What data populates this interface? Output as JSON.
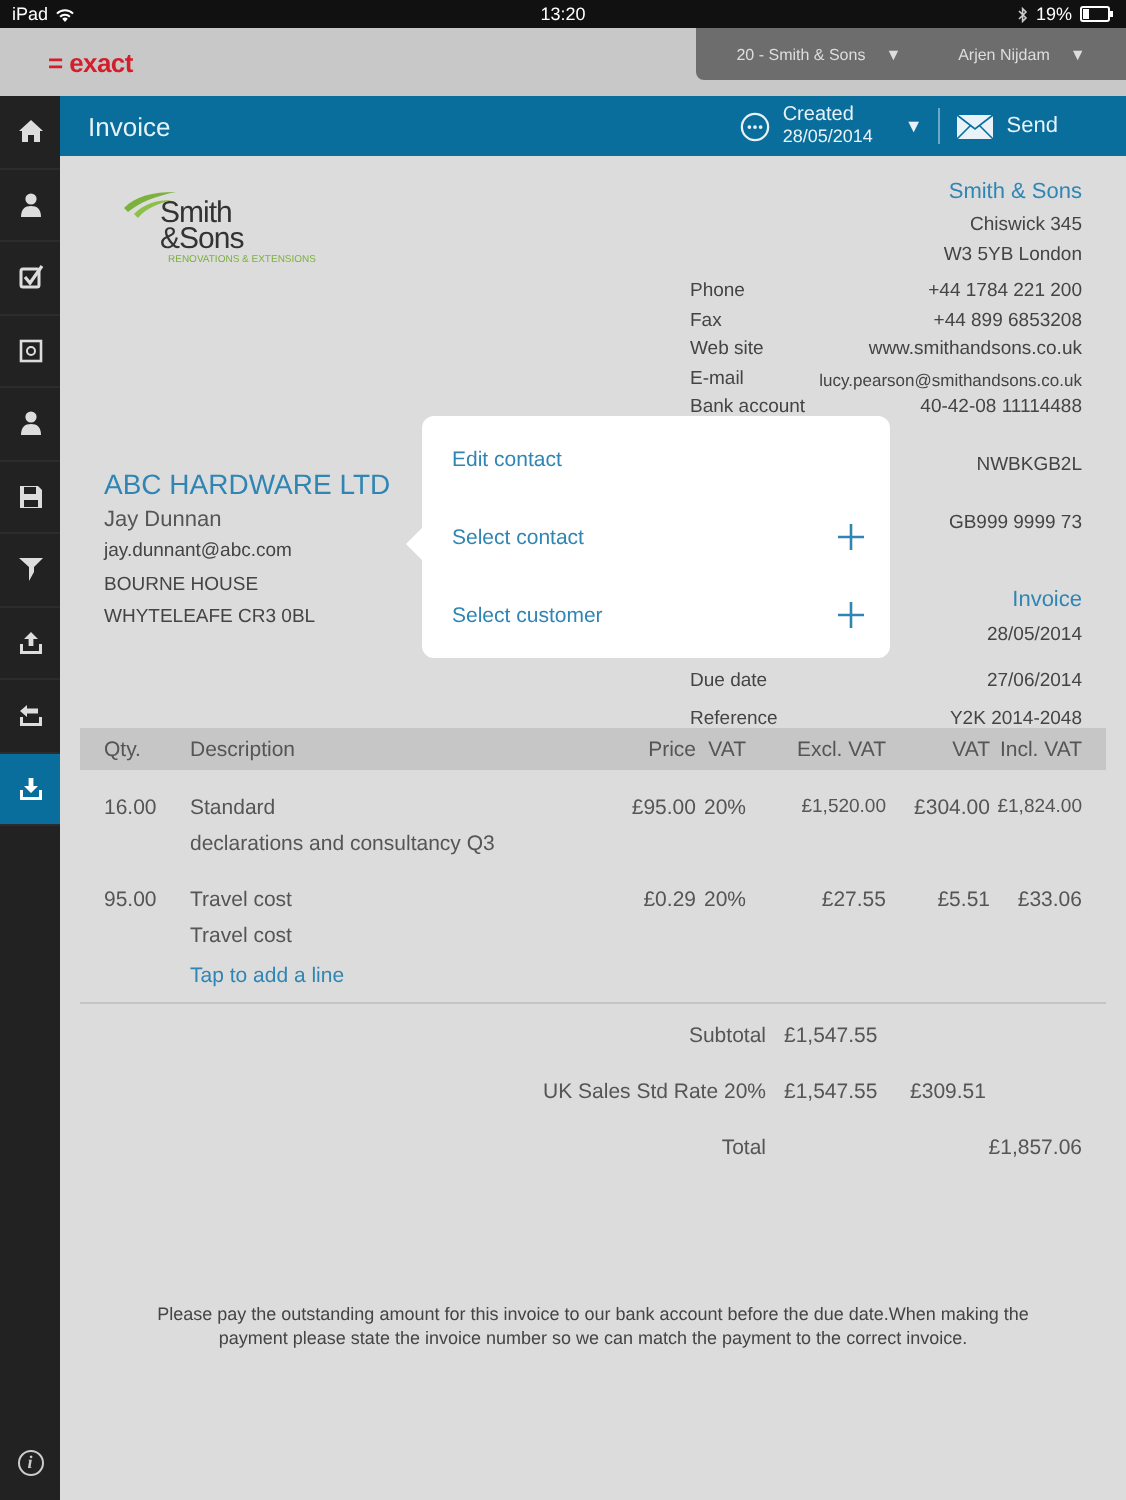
{
  "status_bar": {
    "device": "iPad",
    "time": "13:20",
    "battery": "19%"
  },
  "header": {
    "logo": "= exact",
    "menus": [
      {
        "label": "20 - Smith & Sons",
        "caret": "▼"
      },
      {
        "label": "Arjen Nijdam",
        "caret": "▼"
      }
    ]
  },
  "sidebar": {
    "items": [
      {
        "kind": "home",
        "selected": false
      },
      {
        "kind": "person",
        "selected": false
      },
      {
        "kind": "check",
        "selected": false
      },
      {
        "kind": "safe",
        "selected": false
      },
      {
        "kind": "person",
        "selected": false
      },
      {
        "kind": "floppy",
        "selected": false
      },
      {
        "kind": "funnel",
        "selected": false
      },
      {
        "kind": "upload",
        "selected": false
      },
      {
        "kind": "export",
        "selected": false
      },
      {
        "kind": "download",
        "selected": true
      }
    ],
    "info": "i"
  },
  "toolbar": {
    "title": "Invoice",
    "status": "Created",
    "status_date": "28/05/2014",
    "caret": "▼",
    "send": "Send"
  },
  "logo": {
    "line1": "Smith",
    "line2": "&Sons",
    "tagline": "RENOVATIONS & EXTENSIONS"
  },
  "company": {
    "name": "Smith & Sons",
    "address": [
      "Chiswick 345",
      "W3 5YB London"
    ],
    "groups": [
      [
        {
          "label": "Phone",
          "value": "+44 1784 221 200"
        },
        {
          "label": "Fax",
          "value": "+44 899 6853208"
        },
        {
          "label": "Web site",
          "value": "www.smithandsons.co.uk"
        },
        {
          "label": "E-mail",
          "value": "lucy.pearson@smithandsons.co.uk"
        },
        {
          "label": "Bank account",
          "value": "40-42-08 11114488"
        }
      ],
      [
        {
          "value": "NWBKGB2L"
        }
      ],
      [
        {
          "value": "GB999 9999 73"
        }
      ]
    ]
  },
  "invoice": {
    "heading": "Invoice",
    "rows": [
      {
        "value": "28/05/2014"
      },
      {
        "label": "Due date",
        "value": "27/06/2014"
      },
      {
        "label": "Reference",
        "value": "Y2K 2014-2048"
      }
    ]
  },
  "customer": {
    "name": "ABC HARDWARE LTD",
    "contact": "Jay Dunnan",
    "email": "jay.dunnant@abc.com",
    "address": [
      "BOURNE HOUSE",
      "WHYTELEAFE CR3 0BL"
    ]
  },
  "popover": {
    "items": [
      {
        "label": "Edit contact",
        "plus": false
      },
      {
        "label": "Select contact",
        "plus": true
      },
      {
        "label": "Select customer",
        "plus": true
      }
    ]
  },
  "table": {
    "columns": [
      "Qty.",
      "Description",
      "Price",
      "VAT",
      "Excl. VAT",
      "VAT",
      "Incl. VAT"
    ],
    "rows": [
      {
        "qty": "16.00",
        "description": "Standard",
        "notes": "declarations and consultancy Q3",
        "price": "£95.00",
        "vat_rate": "20%",
        "excl_vat": "£1,520.00",
        "vat": "£304.00",
        "incl_vat": "£1,824.00"
      },
      {
        "qty": "95.00",
        "description": "Travel cost",
        "notes": "Travel cost",
        "price": "£0.29",
        "vat_rate": "20%",
        "excl_vat": "£27.55",
        "vat": "£5.51",
        "incl_vat": "£33.06"
      }
    ],
    "add_line": "Tap to add a line"
  },
  "totals": [
    {
      "label": "Subtotal",
      "excl_vat": "£1,547.55"
    },
    {
      "label": "UK Sales Std Rate 20%",
      "excl_vat": "£1,547.55",
      "vat": "£309.51"
    },
    {
      "label": "Total",
      "total": "£1,857.06"
    }
  ],
  "footer_note": "Please pay the outstanding amount for this invoice to our bank account before the due date.When making the payment please state the invoice number so we can match the payment to the correct invoice."
}
